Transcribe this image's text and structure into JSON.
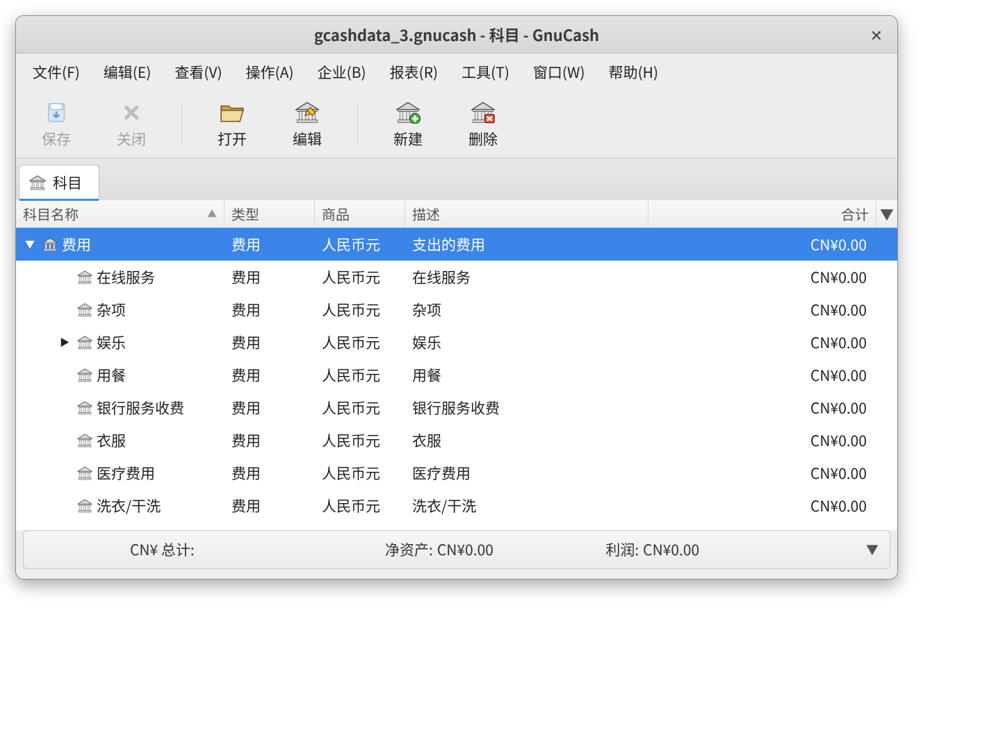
{
  "window": {
    "title": "gcashdata_3.gnucash - 科目 - GnuCash"
  },
  "menubar": [
    "文件(F)",
    "编辑(E)",
    "查看(V)",
    "操作(A)",
    "企业(B)",
    "报表(R)",
    "工具(T)",
    "窗口(W)",
    "帮助(H)"
  ],
  "toolbar": {
    "save": "保存",
    "close": "关闭",
    "open": "打开",
    "edit": "编辑",
    "new": "新建",
    "delete": "删除"
  },
  "tab": {
    "label": "科目"
  },
  "columns": {
    "name": "科目名称",
    "type": "类型",
    "commodity": "商品",
    "desc": "描述",
    "total": "合计"
  },
  "rows": [
    {
      "indent": 0,
      "name": "费用",
      "type": "费用",
      "commodity": "人民币元",
      "desc": "支出的费用",
      "total": "CN¥0.00",
      "expander": "down",
      "selected": true
    },
    {
      "indent": 1,
      "name": "在线服务",
      "type": "费用",
      "commodity": "人民币元",
      "desc": "在线服务",
      "total": "CN¥0.00",
      "expander": "",
      "selected": false
    },
    {
      "indent": 1,
      "name": "杂项",
      "type": "费用",
      "commodity": "人民币元",
      "desc": "杂项",
      "total": "CN¥0.00",
      "expander": "",
      "selected": false
    },
    {
      "indent": 1,
      "name": "娱乐",
      "type": "费用",
      "commodity": "人民币元",
      "desc": "娱乐",
      "total": "CN¥0.00",
      "expander": "right",
      "selected": false
    },
    {
      "indent": 1,
      "name": "用餐",
      "type": "费用",
      "commodity": "人民币元",
      "desc": "用餐",
      "total": "CN¥0.00",
      "expander": "",
      "selected": false
    },
    {
      "indent": 1,
      "name": "银行服务收费",
      "type": "费用",
      "commodity": "人民币元",
      "desc": "银行服务收费",
      "total": "CN¥0.00",
      "expander": "",
      "selected": false
    },
    {
      "indent": 1,
      "name": "衣服",
      "type": "费用",
      "commodity": "人民币元",
      "desc": "衣服",
      "total": "CN¥0.00",
      "expander": "",
      "selected": false
    },
    {
      "indent": 1,
      "name": "医疗费用",
      "type": "费用",
      "commodity": "人民币元",
      "desc": "医疗费用",
      "total": "CN¥0.00",
      "expander": "",
      "selected": false
    },
    {
      "indent": 1,
      "name": "洗衣/干洗",
      "type": "费用",
      "commodity": "人民币元",
      "desc": "洗衣/干洗",
      "total": "CN¥0.00",
      "expander": "",
      "selected": false
    }
  ],
  "status": {
    "grand": "CN¥ 总计:",
    "net_label": "净资产:",
    "net_value": "CN¥0.00",
    "profit_label": "利润:",
    "profit_value": "CN¥0.00"
  }
}
